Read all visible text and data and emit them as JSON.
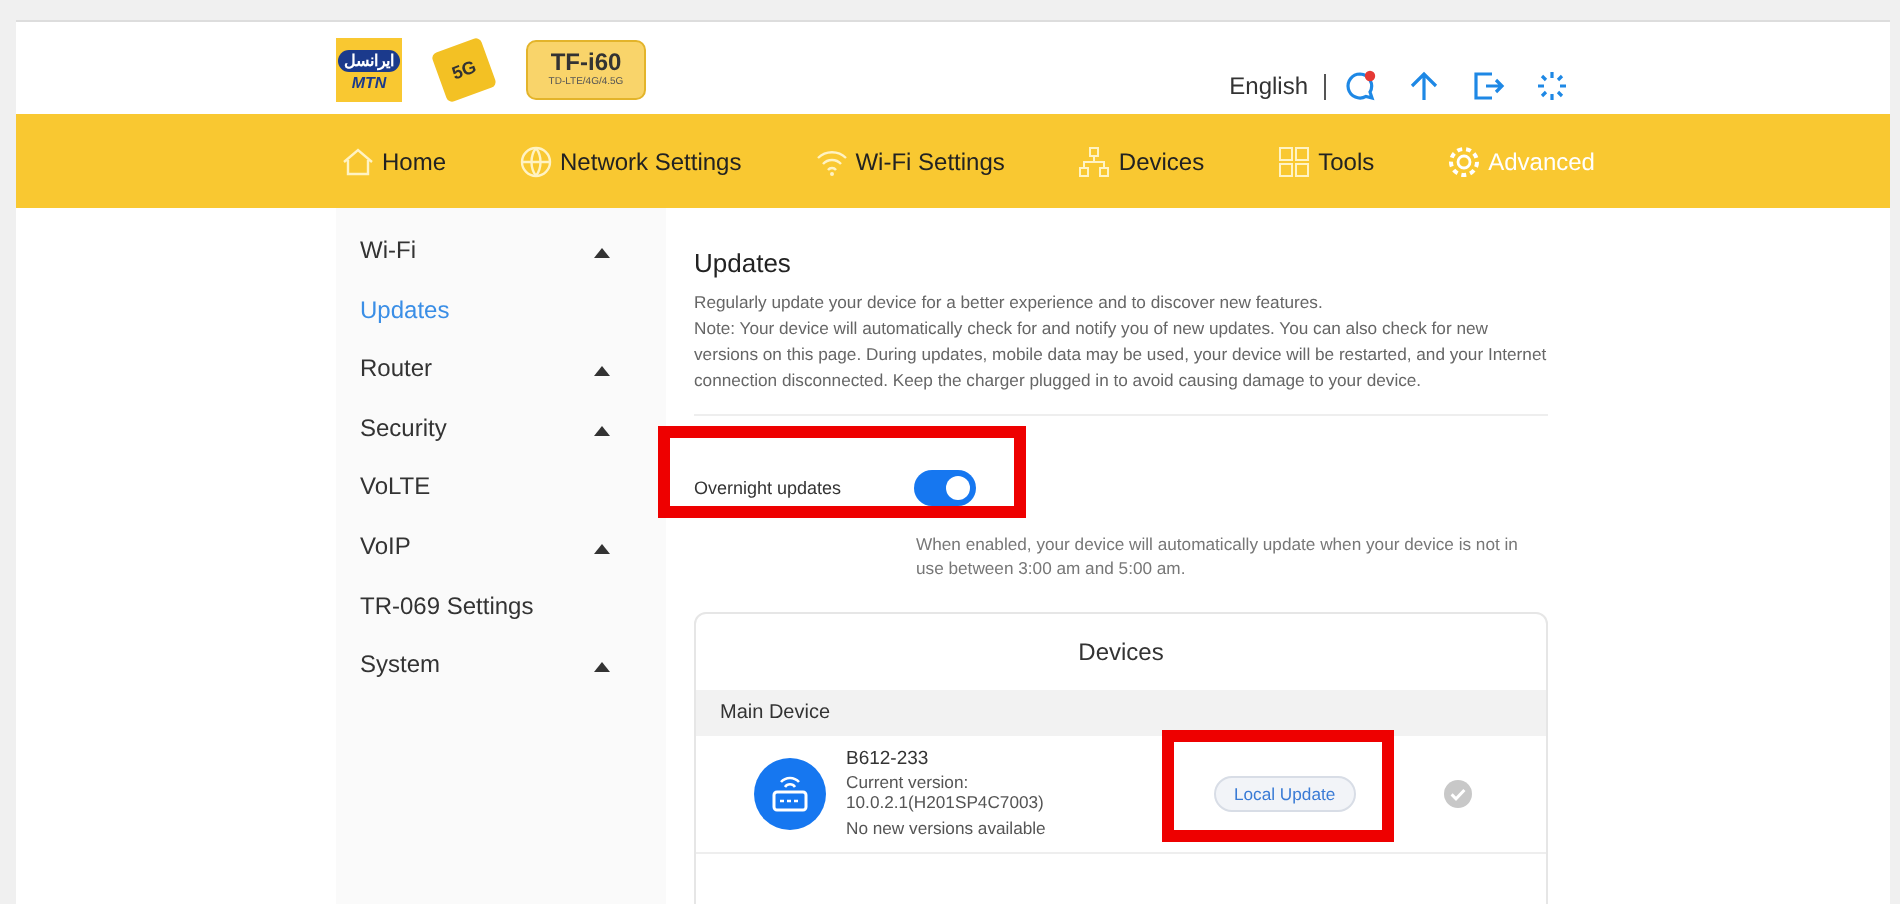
{
  "header": {
    "logos": [
      {
        "kind": "operator",
        "lines": [
          "ایرانسل",
          "MTN"
        ]
      },
      {
        "kind": "cube",
        "lines": [
          "5G"
        ]
      },
      {
        "kind": "model",
        "lines": [
          "TF-i60",
          "TD-LTE/4G/4.5G"
        ]
      }
    ],
    "language": "English"
  },
  "nav": [
    {
      "label": "Home",
      "kind": "home",
      "selected": false
    },
    {
      "label": "Network Settings",
      "kind": "globe",
      "selected": false
    },
    {
      "label": "Wi-Fi Settings",
      "kind": "wifi",
      "selected": false
    },
    {
      "label": "Devices",
      "kind": "network",
      "selected": false
    },
    {
      "label": "Tools",
      "kind": "tools",
      "selected": false
    },
    {
      "label": "Advanced",
      "kind": "gear",
      "selected": true
    }
  ],
  "sidebar": {
    "items": [
      {
        "label": "Wi-Fi",
        "selected": false,
        "has_submenu": true
      },
      {
        "label": "Updates",
        "selected": true,
        "has_submenu": false
      },
      {
        "label": "Router",
        "selected": false,
        "has_submenu": true
      },
      {
        "label": "Security",
        "selected": false,
        "has_submenu": true
      },
      {
        "label": "VoLTE",
        "selected": false,
        "has_submenu": false
      },
      {
        "label": "VoIP",
        "selected": false,
        "has_submenu": true
      },
      {
        "label": "TR-069 Settings",
        "selected": false,
        "has_submenu": false
      },
      {
        "label": "System",
        "selected": false,
        "has_submenu": true
      }
    ]
  },
  "updates": {
    "title": "Updates",
    "description": [
      "Regularly update your device for a better experience and to discover new features.",
      "Note: Your device will automatically check for and notify you of new updates. You can also check for new versions on this page. During updates, mobile data may be used, your device will be restarted, and your Internet connection disconnected. Keep the charger plugged in to avoid causing damage to your device."
    ],
    "overnight": {
      "label": "Overnight updates",
      "on": true,
      "highlighted": true,
      "hint": "When enabled, your device will automatically update when your device is not in use between 3:00 am and 5:00 am."
    },
    "devices": {
      "title": "Devices",
      "group": "Main Device",
      "items": [
        {
          "name": "B612-233",
          "version_label": "Current version:",
          "version": "10.0.2.1(H201SP4C7003)",
          "status": "No new versions available",
          "button": "Local Update",
          "highlighted": true,
          "checked": false
        }
      ]
    }
  }
}
